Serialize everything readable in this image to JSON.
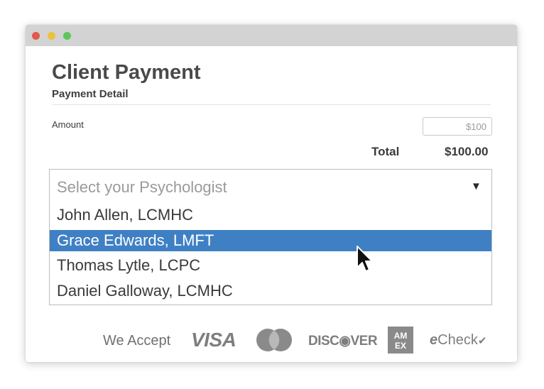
{
  "form": {
    "title": "Client Payment",
    "subtitle": "Payment Detail",
    "amount_label": "Amount",
    "amount_placeholder": "$100",
    "total_label": "Total",
    "total_value": "$100.00"
  },
  "psychologist_select": {
    "placeholder": "Select your Psychologist",
    "arrow": "▼",
    "options": [
      {
        "label": "John Allen, LCMHC",
        "selected": false
      },
      {
        "label": "Grace Edwards, LMFT",
        "selected": true
      },
      {
        "label": "Thomas Lytle, LCPC",
        "selected": false
      },
      {
        "label": "Daniel Galloway, LCMHC",
        "selected": false
      }
    ]
  },
  "payment_methods": {
    "label": "We Accept",
    "visa": "VISA",
    "mastercard_icon": "mastercard-icon",
    "discover": "DISC◉VER",
    "amex_icon": "amex-icon",
    "echeck_e": "e",
    "echeck_rest": "Check"
  },
  "colors": {
    "selected_option": "#3f80c4",
    "titlebar": "#d3d3d3",
    "close": "#e4584f",
    "minimize": "#e9c33b",
    "maximize": "#5ec55a"
  }
}
